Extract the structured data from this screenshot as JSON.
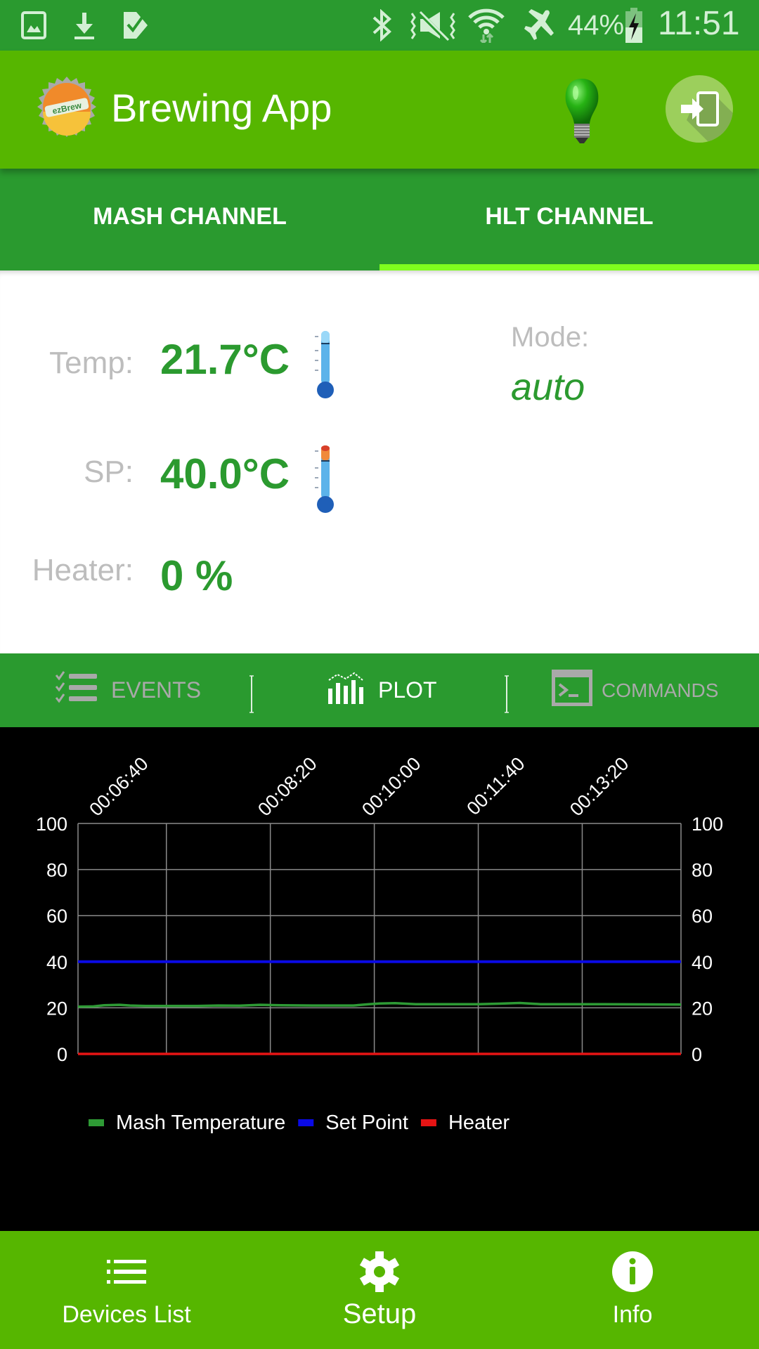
{
  "status_bar": {
    "icons_left": [
      "gallery-icon",
      "download-icon",
      "task-check-icon"
    ],
    "icons_right": [
      "bluetooth-icon",
      "vibrate-mute-icon",
      "wifi-icon",
      "airplane-icon",
      "battery-charging-icon"
    ],
    "battery": "44%",
    "time": "11:51"
  },
  "app_bar": {
    "title": "Brewing App",
    "logo": "bottle-cap-logo",
    "bulb_icon": "lightbulb-icon",
    "logout_icon": "sign-in-icon"
  },
  "tabs": [
    {
      "label": "MASH CHANNEL",
      "active": false
    },
    {
      "label": "HLT CHANNEL",
      "active": true
    }
  ],
  "readings": {
    "temp_label": "Temp:",
    "temp_value": "21.7°C",
    "sp_label": "SP:",
    "sp_value": "40.0°C",
    "heater_label": "Heater:",
    "heater_value": "0 %",
    "mode_label": "Mode:",
    "mode_value": "auto"
  },
  "section_tabs": [
    {
      "label": "EVENTS",
      "icon": "checklist-icon",
      "active": false
    },
    {
      "label": "PLOT",
      "icon": "bar-chart-icon",
      "active": true
    },
    {
      "label": "COMMANDS",
      "icon": "terminal-icon",
      "active": false
    }
  ],
  "bottom_nav": [
    {
      "label": "Devices List",
      "icon": "list-icon"
    },
    {
      "label": "Setup",
      "icon": "gear-icon"
    },
    {
      "label": "Info",
      "icon": "info-icon"
    }
  ],
  "colors": {
    "status_bar": "#2a9a2f",
    "app_bar": "#56b600",
    "tab_indicator": "#7fff1e",
    "value_green": "#2b9a2f",
    "mash_temp": "#2e9a35",
    "set_point": "#0a0ae6",
    "heater": "#e61414"
  },
  "chart_data": {
    "type": "line",
    "background": "black",
    "x_type": "time (mm:ss elapsed)",
    "x_range_seconds": [
      315,
      895
    ],
    "x_ticks": [
      {
        "seconds": 400,
        "label": "00:06:40"
      },
      {
        "seconds": 500,
        "label": "00:08:20"
      },
      {
        "seconds": 600,
        "label": "00:10:00"
      },
      {
        "seconds": 700,
        "label": "00:11:40"
      },
      {
        "seconds": 800,
        "label": "00:13:20"
      }
    ],
    "ylim": [
      0,
      100
    ],
    "y_ticks": [
      0,
      20,
      40,
      60,
      80,
      100
    ],
    "y_axis_left": true,
    "y_axis_right": true,
    "grid": true,
    "legend_position": "bottom-left",
    "series": [
      {
        "name": "Mash Temperature",
        "color": "#2e9a35",
        "x": [
          315,
          330,
          340,
          355,
          365,
          380,
          400,
          430,
          450,
          470,
          490,
          510,
          540,
          560,
          580,
          595,
          605,
          620,
          640,
          680,
          690,
          700,
          720,
          740,
          760,
          790,
          820,
          860,
          895
        ],
        "y": [
          20.5,
          20.6,
          21.1,
          21.3,
          21.0,
          20.8,
          20.8,
          20.8,
          21.0,
          20.9,
          21.3,
          21.1,
          21.0,
          21.0,
          21.0,
          21.6,
          21.9,
          22.0,
          21.6,
          21.6,
          21.6,
          21.6,
          21.8,
          22.1,
          21.6,
          21.6,
          21.6,
          21.5,
          21.4
        ]
      },
      {
        "name": "Set Point",
        "color": "#0a0ae6",
        "x": [
          315,
          895
        ],
        "y": [
          40.0,
          40.0
        ]
      },
      {
        "name": "Heater",
        "color": "#e61414",
        "x": [
          315,
          895
        ],
        "y": [
          0,
          0
        ]
      }
    ]
  }
}
